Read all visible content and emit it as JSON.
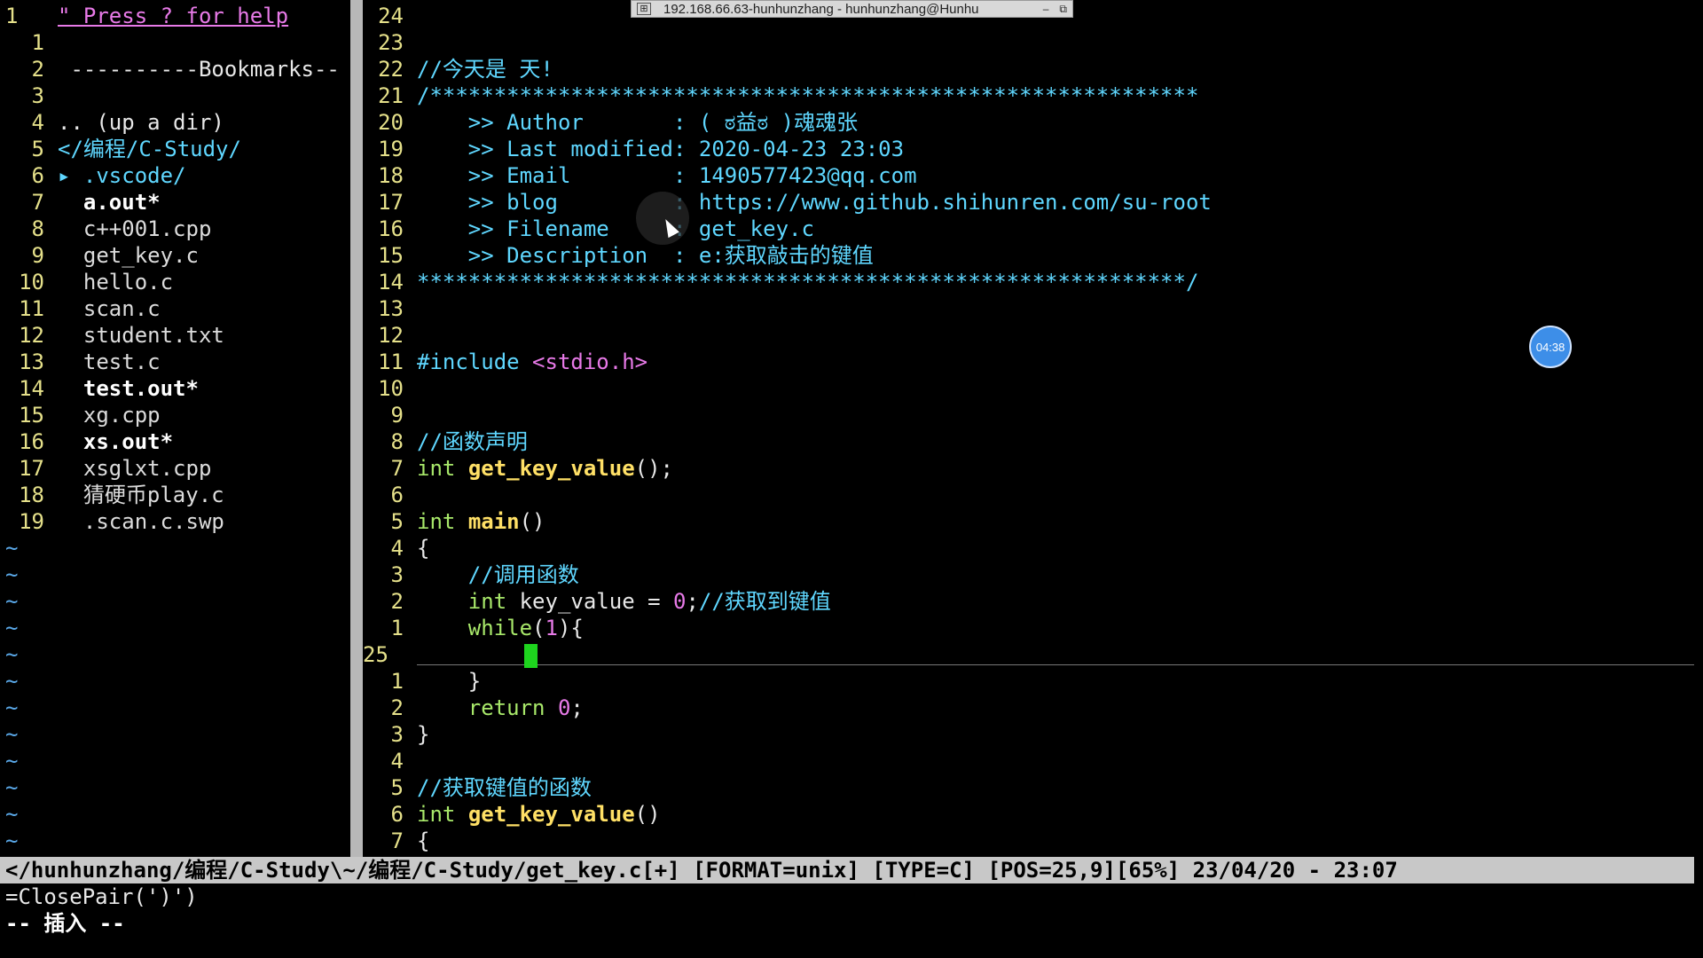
{
  "window": {
    "title": "192.168.66.63-hunhunzhang - hunhunzhang@Hunhu",
    "minimize": "–",
    "restore": "⧉"
  },
  "tree": {
    "header_num": "1",
    "help": "\" Press ? for help",
    "lines": [
      {
        "n": "1",
        "t": ""
      },
      {
        "n": "2",
        "t": " ----------Bookmarks--"
      },
      {
        "n": "3",
        "t": ""
      },
      {
        "n": "4",
        "t": ".. (up a dir)"
      },
      {
        "n": "5",
        "t": "</编程/C-Study/"
      },
      {
        "n": "6",
        "t": "▸ .vscode/"
      },
      {
        "n": "7",
        "t": "  a.out*"
      },
      {
        "n": "8",
        "t": "  c++001.cpp"
      },
      {
        "n": "9",
        "t": "  get_key.c"
      },
      {
        "n": "10",
        "t": "  hello.c"
      },
      {
        "n": "11",
        "t": "  scan.c"
      },
      {
        "n": "12",
        "t": "  student.txt"
      },
      {
        "n": "13",
        "t": "  test.c"
      },
      {
        "n": "14",
        "t": "  test.out*"
      },
      {
        "n": "15",
        "t": "  xg.cpp"
      },
      {
        "n": "16",
        "t": "  xs.out*"
      },
      {
        "n": "17",
        "t": "  xsglxt.cpp"
      },
      {
        "n": "18",
        "t": "  猜硬币play.c"
      },
      {
        "n": "19",
        "t": "  .scan.c.swp"
      }
    ],
    "tilde": "~"
  },
  "code": {
    "lines": [
      {
        "n": "24",
        "t": ""
      },
      {
        "n": "23",
        "t": ""
      },
      {
        "n": "22",
        "t": "//今天是 天!"
      },
      {
        "n": "21",
        "t": "/************************************************************"
      },
      {
        "n": "20",
        "t": "    >> Author       : ( ಠ益ಠ )魂魂张"
      },
      {
        "n": "19",
        "t": "    >> Last modified: 2020-04-23 23:03"
      },
      {
        "n": "18",
        "t": "    >> Email        : 1490577423@qq.com"
      },
      {
        "n": "17",
        "t": "    >> blog         : https://www.github.shihunren.com/su-root"
      },
      {
        "n": "16",
        "t": "    >> Filename     : get_key.c"
      },
      {
        "n": "15",
        "t": "    >> Description  : e:获取敲击的键值"
      },
      {
        "n": "14",
        "t": "************************************************************/"
      },
      {
        "n": "13",
        "t": ""
      },
      {
        "n": "12",
        "t": ""
      },
      {
        "n": "11",
        "t": "#include <stdio.h>"
      },
      {
        "n": "10",
        "t": ""
      },
      {
        "n": "9",
        "t": ""
      },
      {
        "n": "8",
        "t": "//函数声明"
      },
      {
        "n": "7",
        "t": "int get_key_value();"
      },
      {
        "n": "6",
        "t": ""
      },
      {
        "n": "5",
        "t": "int main()"
      },
      {
        "n": "4",
        "t": "{"
      },
      {
        "n": "3",
        "t": "    //调用函数"
      },
      {
        "n": "2",
        "t": "    int key_value = 0;//获取到键值"
      },
      {
        "n": "1",
        "t": "    while(1){"
      },
      {
        "n": "25",
        "t": ""
      },
      {
        "n": "1",
        "t": "    }"
      },
      {
        "n": "2",
        "t": "    return 0;"
      },
      {
        "n": "3",
        "t": "}"
      },
      {
        "n": "4",
        "t": ""
      },
      {
        "n": "5",
        "t": "//获取键值的函数"
      },
      {
        "n": "6",
        "t": "int get_key_value()"
      },
      {
        "n": "7",
        "t": "{"
      }
    ]
  },
  "statusbar": "</hunhunzhang/编程/C-Study\\~/编程/C-Study/get_key.c[+] [FORMAT=unix] [TYPE=C] [POS=25,9][65%] 23/04/20 - 23:07",
  "cmdline": "=ClosePair(')')",
  "mode": "-- 插入 --",
  "timer": "04:38"
}
